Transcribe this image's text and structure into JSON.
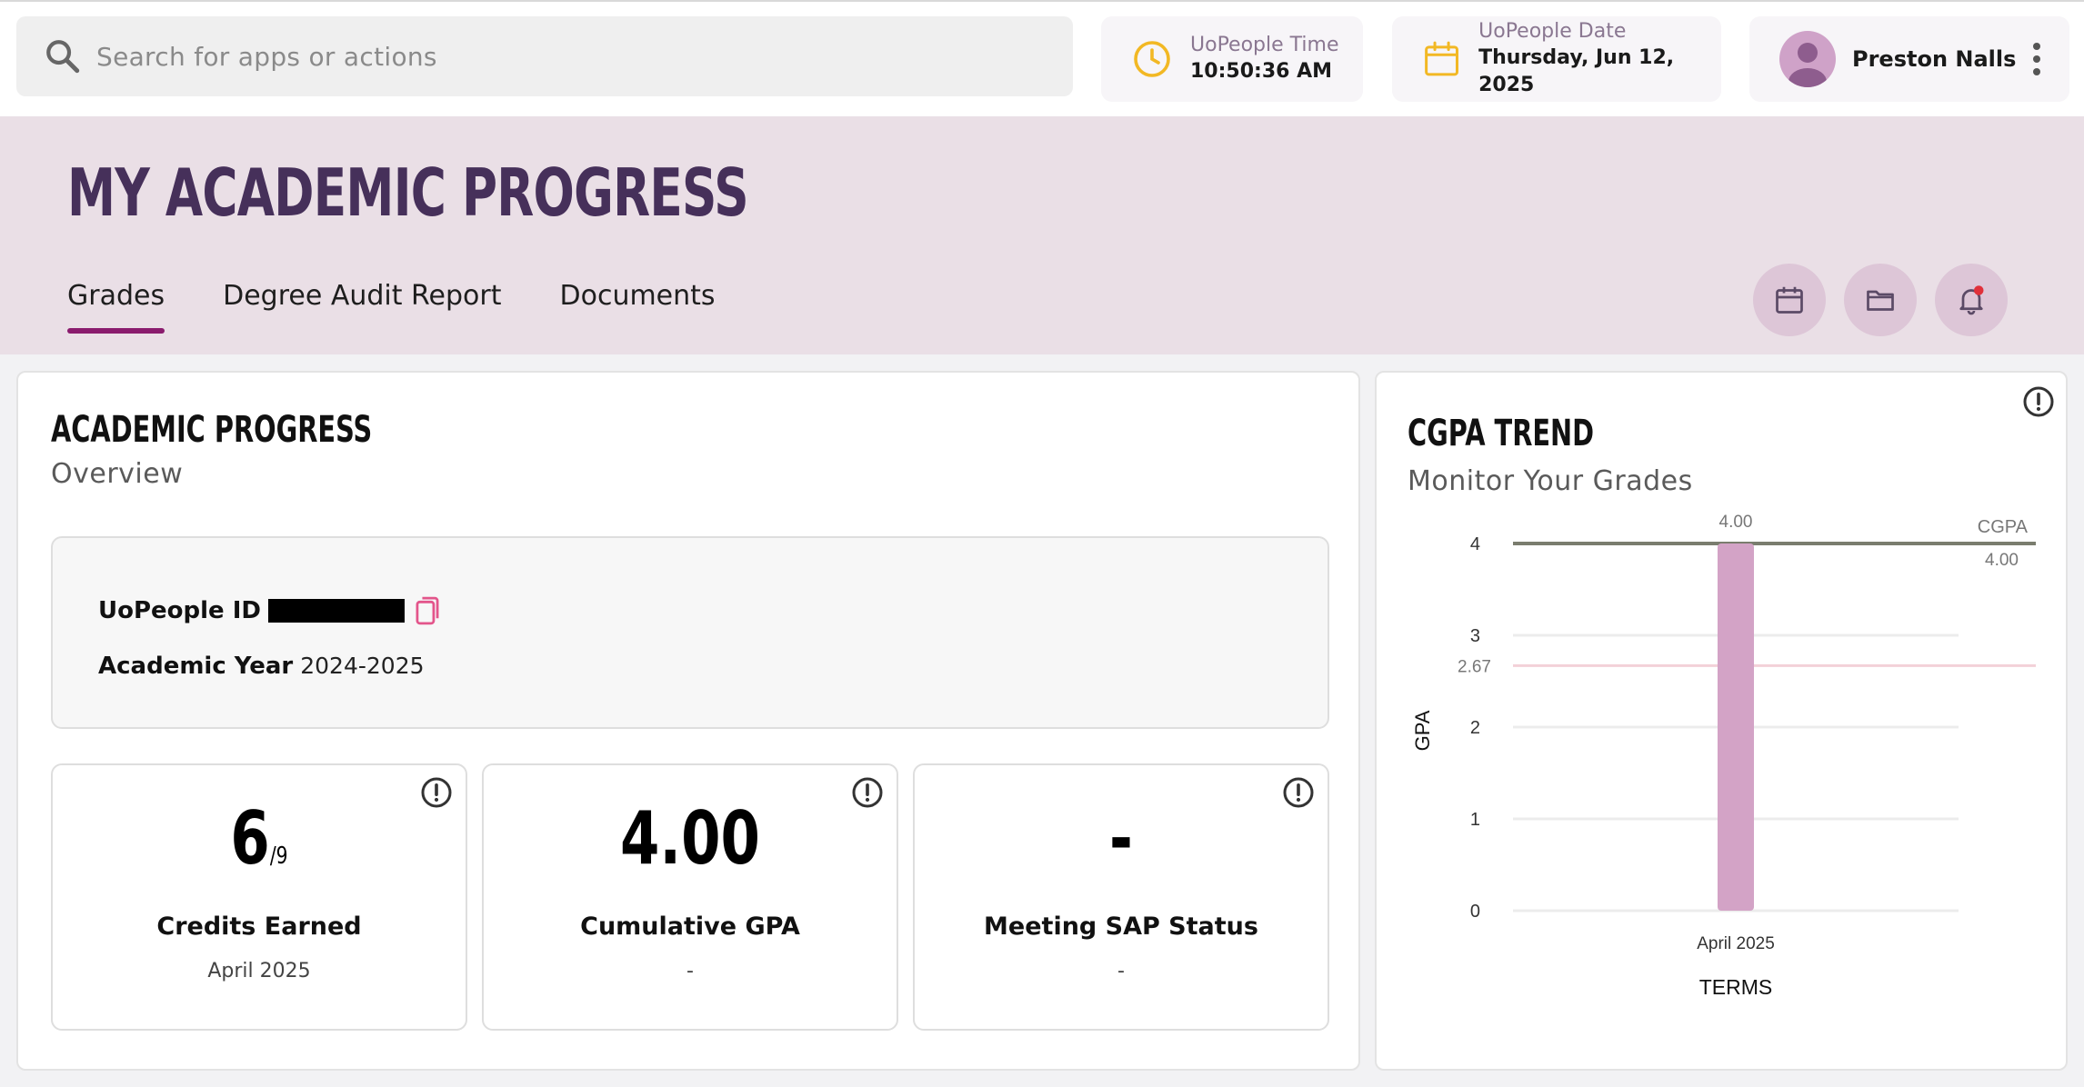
{
  "search": {
    "placeholder": "Search for apps or actions",
    "icon": "search-icon"
  },
  "time": {
    "label": "UoPeople Time",
    "value": "10:50:36 AM",
    "icon": "clock-icon",
    "color": "#f2b824"
  },
  "date": {
    "label": "UoPeople Date",
    "value": "Thursday, Jun 12, 2025",
    "icon": "calendar-icon",
    "color": "#f2b824"
  },
  "user": {
    "name": "Preston Nalls",
    "avatar": "avatar-icon",
    "menu": "kebab-menu-icon"
  },
  "page": {
    "title": "MY ACADEMIC PROGRESS",
    "tabs": [
      {
        "label": "Grades",
        "active": true
      },
      {
        "label": "Degree Audit Report",
        "active": false
      },
      {
        "label": "Documents",
        "active": false
      }
    ],
    "action_icons": [
      "calendar-icon",
      "folder-icon",
      "bell-icon"
    ],
    "accent": "#8a1b6d"
  },
  "academic_progress": {
    "title": "ACADEMIC PROGRESS",
    "subtitle": "Overview",
    "id_label": "UoPeople ID",
    "year_label": "Academic Year",
    "year_value": "2024-2025",
    "stats": [
      {
        "value": "6",
        "denominator": "/9",
        "label": "Credits Earned",
        "sub": "April 2025"
      },
      {
        "value": "4.00",
        "denominator": "",
        "label": "Cumulative GPA",
        "sub": "-"
      },
      {
        "value": "-",
        "denominator": "",
        "label": "Meeting SAP Status",
        "sub": "-"
      }
    ]
  },
  "cgpa_trend": {
    "title": "CGPA TREND",
    "subtitle": "Monitor Your Grades"
  },
  "chart_data": {
    "type": "bar",
    "categories": [
      "April 2025"
    ],
    "values": [
      4.0
    ],
    "data_labels": [
      "4.00"
    ],
    "ylabel": "GPA",
    "xlabel": "TERMS",
    "ylim": [
      0,
      4
    ],
    "yticks": [
      0,
      1,
      2,
      3,
      4
    ],
    "bar_color": "#d3a3c6",
    "reference_lines": [
      {
        "name": "CGPA",
        "value": 4.0,
        "label": "4.00",
        "color": "#7a7d6e"
      },
      {
        "value": 2.67,
        "label": "2.67",
        "color": "#f3d1d8"
      }
    ],
    "grid": true
  }
}
